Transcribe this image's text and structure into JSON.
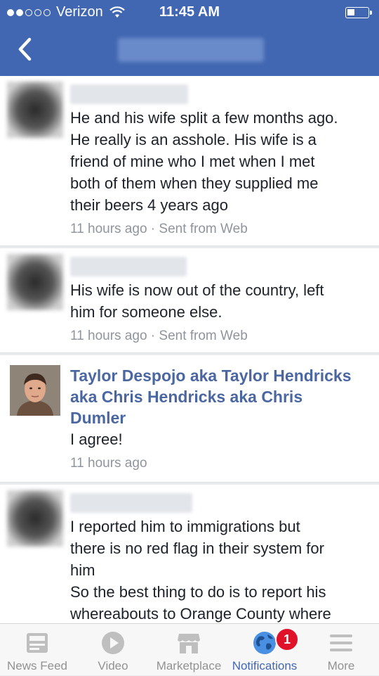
{
  "status": {
    "carrier": "Verizon",
    "time": "11:45 AM"
  },
  "header": {
    "back_icon": "chevron-left-icon"
  },
  "comments": [
    {
      "text": "He and his wife split a few months ago.\nHe really is an asshole. His wife is a\nfriend of mine who I met when I met\nboth of them when they supplied me\ntheir beers 4 years ago",
      "meta": "11 hours ago · Sent from Web"
    },
    {
      "text": "His wife is now out of the country, left\nhim for someone else.",
      "meta": "11 hours ago · Sent from Web"
    },
    {
      "name": "Taylor Despojo aka Taylor Hendricks\naka Chris Hendricks aka Chris\nDumler",
      "text": "I agree!",
      "meta": "11 hours ago"
    },
    {
      "text": "I reported him to immigrations but\nthere is no red flag in their system for\nhim\nSo the best thing to do is to report his\nwhereabouts to Orange County where"
    }
  ],
  "tabbar": {
    "items": [
      {
        "label": "News Feed",
        "icon": "news-feed-icon"
      },
      {
        "label": "Video",
        "icon": "video-play-icon"
      },
      {
        "label": "Marketplace",
        "icon": "marketplace-store-icon"
      },
      {
        "label": "Notifications",
        "icon": "globe-icon",
        "badge": "1"
      },
      {
        "label": "More",
        "icon": "menu-icon"
      }
    ]
  },
  "colors": {
    "brand": "#4267b2",
    "badge": "#e0122a",
    "name_link": "#4b67a1"
  }
}
